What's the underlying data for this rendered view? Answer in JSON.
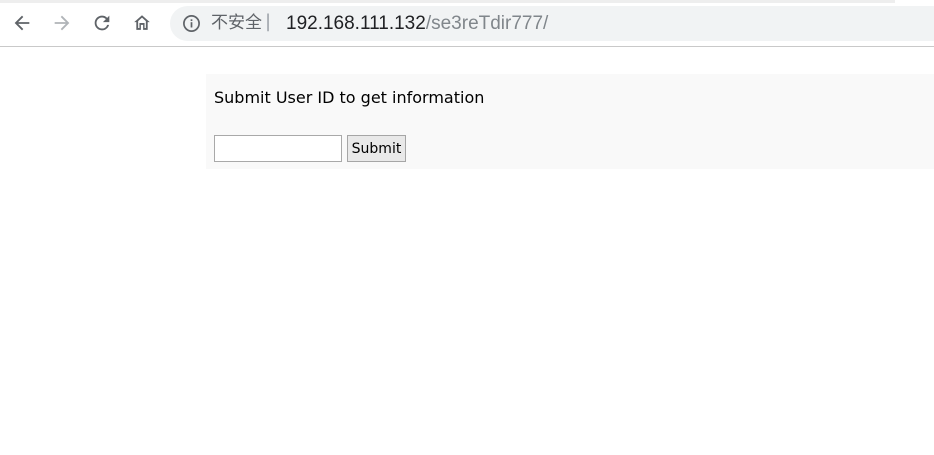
{
  "browser": {
    "nav": {
      "back_icon": "arrow-left-icon",
      "forward_icon": "arrow-right-icon",
      "reload_icon": "reload-icon",
      "home_icon": "home-icon"
    },
    "address_bar": {
      "info_icon": "info-circle-icon",
      "security_label": "不安全",
      "separator": "|",
      "url_host": "192.168.111.132",
      "url_path": "/se3reTdir777/"
    },
    "colors": {
      "toolbar_bg": "#ffffff",
      "omnibox_bg": "#f1f3f4",
      "icon_color": "#5f6368",
      "disabled_icon_color": "#b0b4b8"
    }
  },
  "page": {
    "heading": "Submit User ID to get information",
    "user_id_input": {
      "value": "",
      "placeholder": ""
    },
    "submit_label": "Submit",
    "colors": {
      "panel_bg": "#f9f9f9"
    }
  }
}
